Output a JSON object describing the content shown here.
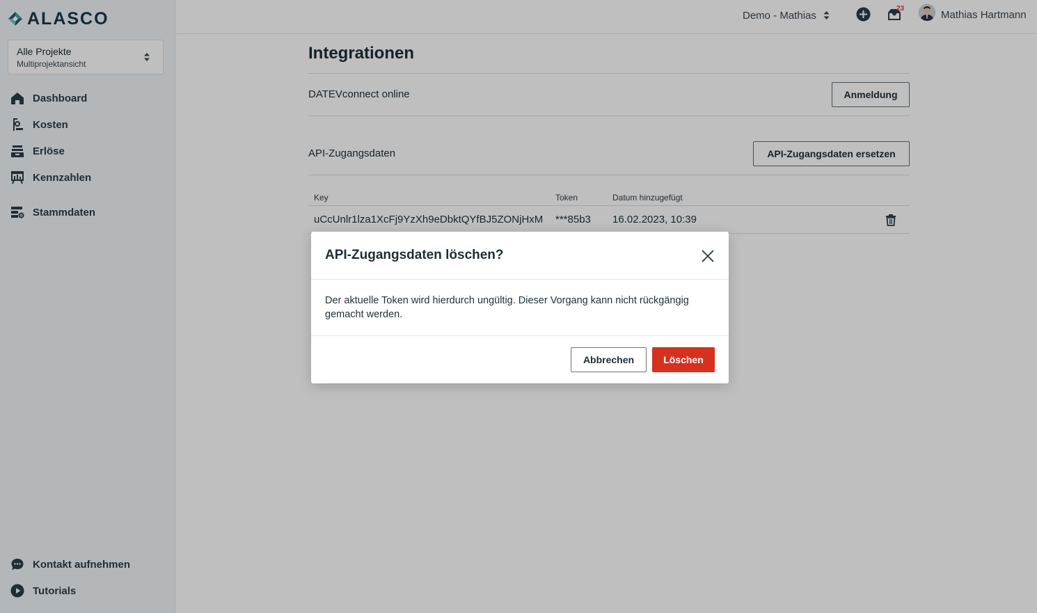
{
  "sidebar": {
    "logo_text": "ALASCO",
    "project": {
      "title": "Alle Projekte",
      "subtitle": "Multiprojektansicht"
    },
    "items": [
      {
        "label": "Dashboard",
        "icon": "home-icon"
      },
      {
        "label": "Kosten",
        "icon": "costs-icon"
      },
      {
        "label": "Erlöse",
        "icon": "revenue-icon"
      },
      {
        "label": "Kennzahlen",
        "icon": "chart-icon"
      },
      {
        "label": "Stammdaten",
        "icon": "master-data-icon"
      }
    ],
    "bottom_items": [
      {
        "label": "Kontakt aufnehmen",
        "icon": "chat-icon"
      },
      {
        "label": "Tutorials",
        "icon": "play-icon"
      }
    ]
  },
  "topbar": {
    "org": "Demo - Mathias",
    "notification_count": "23",
    "user_name": "Mathias Hartmann"
  },
  "main": {
    "title": "Integrationen",
    "datev": {
      "label": "DATEVconnect online",
      "button": "Anmeldung"
    },
    "api": {
      "label": "API-Zugangsdaten",
      "button": "API-Zugangsdaten ersetzen"
    },
    "table": {
      "headers": [
        "Key",
        "Token",
        "Datum hinzugefügt"
      ],
      "rows": [
        {
          "key": "uCcUnlr1lza1XcFj9YzXh9eDbktQYfBJ5ZONjHxM",
          "token": "***85b3",
          "date": "16.02.2023, 10:39"
        }
      ]
    }
  },
  "modal": {
    "title": "API-Zugangsdaten löschen?",
    "body": "Der aktuelle Token wird hierdurch ungültig. Dieser Vorgang kann nicht rückgängig gemacht werden.",
    "cancel": "Abbrechen",
    "confirm": "Löschen"
  },
  "colors": {
    "brand": "#19394a",
    "danger": "#d6311f",
    "sidebar_bg": "#f1f4f8"
  }
}
